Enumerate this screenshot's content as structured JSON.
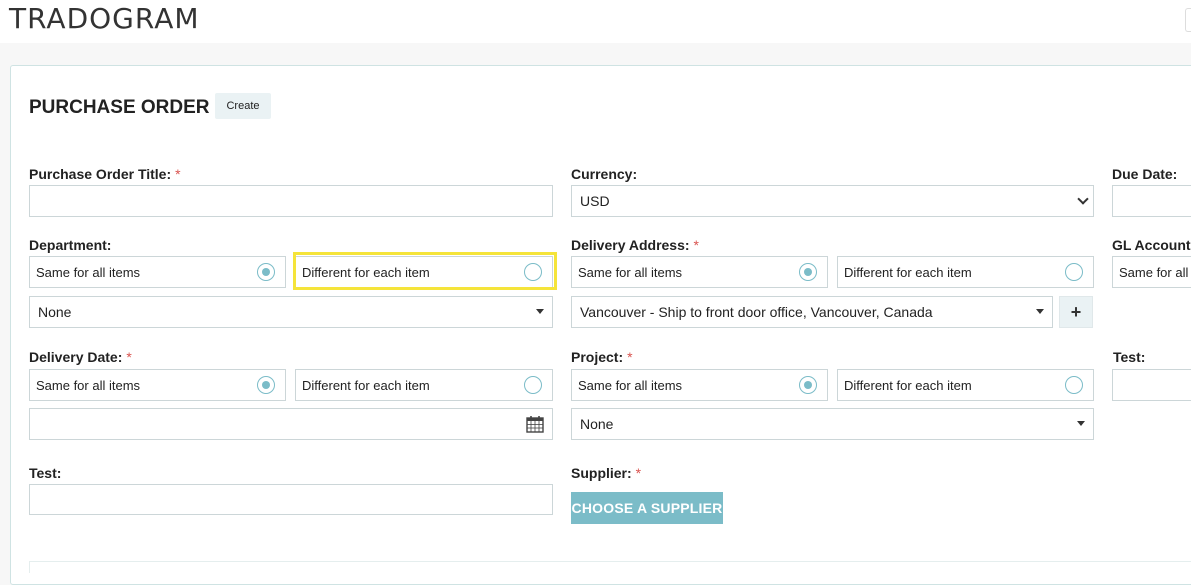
{
  "brand": {
    "logo_text": "TRADOGRAM"
  },
  "page": {
    "title": "PURCHASE ORDER",
    "badge": "Create"
  },
  "fields": {
    "po_title": {
      "label": "Purchase Order Title:",
      "required": "*",
      "value": ""
    },
    "currency": {
      "label": "Currency:",
      "value": "USD"
    },
    "due_date": {
      "label": "Due Date:",
      "value": ""
    },
    "department": {
      "label": "Department:",
      "option_same": "Same for all items",
      "option_diff": "Different for each item",
      "selected": "same",
      "value": "None"
    },
    "delivery_address": {
      "label": "Delivery Address:",
      "required": "*",
      "option_same": "Same for all items",
      "option_diff": "Different for each item",
      "selected": "same",
      "value": "Vancouver - Ship to front door office, Vancouver, Canada",
      "add_label": "+"
    },
    "gl_account": {
      "label": "GL Account",
      "option_same": "Same for all"
    },
    "delivery_date": {
      "label": "Delivery Date:",
      "required": "*",
      "option_same": "Same for all items",
      "option_diff": "Different for each item",
      "selected": "same",
      "value": ""
    },
    "project": {
      "label": "Project:",
      "required": "*",
      "option_same": "Same for all items",
      "option_diff": "Different for each item",
      "selected": "same",
      "value": "None"
    },
    "test_right": {
      "label": "Test:"
    },
    "test": {
      "label": "Test:",
      "value": ""
    },
    "supplier": {
      "label": "Supplier:",
      "required": "*",
      "button": "CHOOSE A SUPPLIER"
    }
  },
  "colors": {
    "accent": "#7bbcc8",
    "highlight": "#f5e43a",
    "required": "#d9534f"
  },
  "icons": {
    "calendar": "calendar-icon",
    "caret": "caret-down-icon",
    "chevron": "chevron-down-icon"
  }
}
